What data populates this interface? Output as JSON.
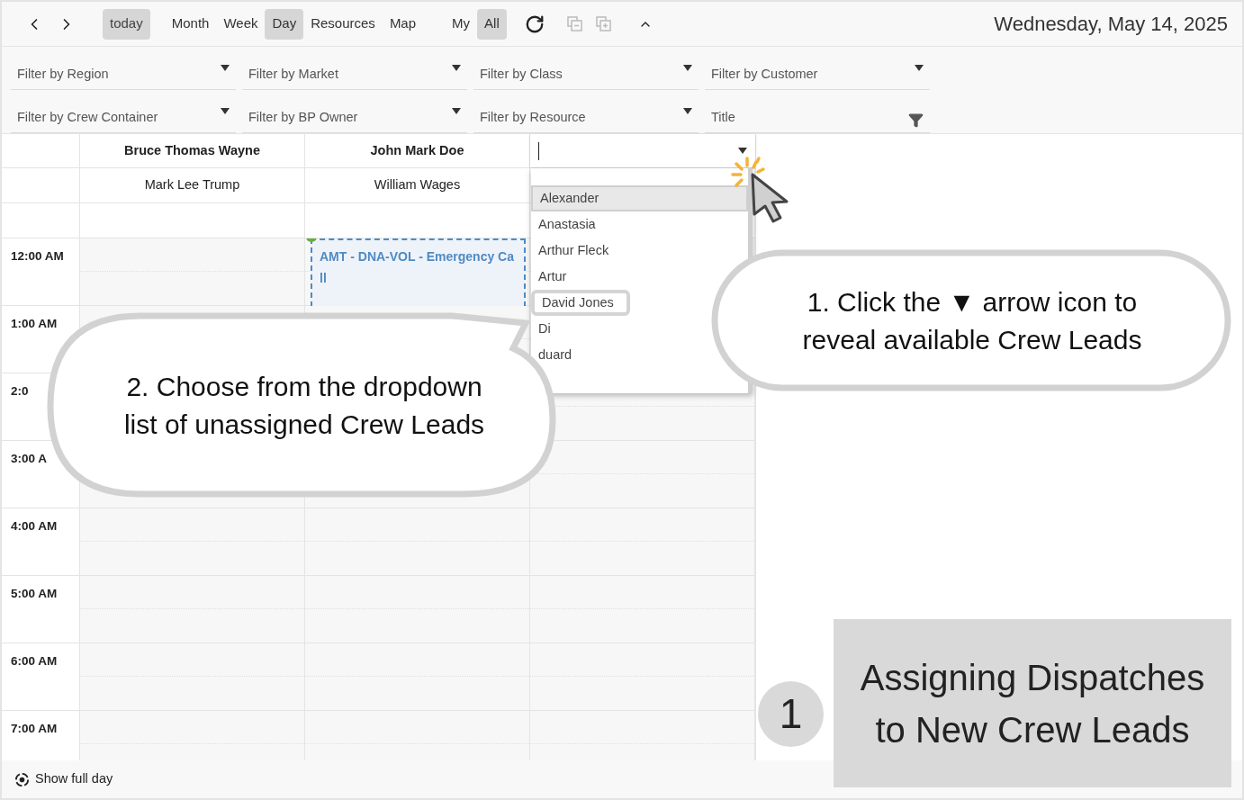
{
  "toolbar": {
    "today": "today",
    "views": [
      {
        "label": "Month",
        "selected": false
      },
      {
        "label": "Week",
        "selected": false
      },
      {
        "label": "Day",
        "selected": true
      },
      {
        "label": "Resources",
        "selected": false
      },
      {
        "label": "Map",
        "selected": false
      }
    ],
    "scopes": [
      {
        "label": "My",
        "selected": false
      },
      {
        "label": "All",
        "selected": true
      }
    ],
    "date": "Wednesday, May 14, 2025"
  },
  "filters": [
    {
      "kind": "dropdown",
      "placeholder": "Filter by Region"
    },
    {
      "kind": "dropdown",
      "placeholder": "Filter by Market"
    },
    {
      "kind": "dropdown",
      "placeholder": "Filter by Class"
    },
    {
      "kind": "dropdown",
      "placeholder": "Filter by Customer"
    },
    {
      "kind": "dropdown",
      "placeholder": "Filter by Crew Container"
    },
    {
      "kind": "dropdown",
      "placeholder": "Filter by BP Owner"
    },
    {
      "kind": "dropdown",
      "placeholder": "Filter by Resource"
    },
    {
      "kind": "text",
      "placeholder": "Title"
    }
  ],
  "resources": [
    {
      "kind": "named",
      "name": "Bruce Thomas Wayne",
      "crew_lead": "Mark Lee Trump"
    },
    {
      "kind": "named",
      "name": "John Mark Doe",
      "crew_lead": "William Wages",
      "event": {
        "title": "AMT - DNA-VOL - Emergency Call"
      }
    },
    {
      "kind": "picker"
    }
  ],
  "crew_picker": {
    "options": [
      {
        "label": "Alexander",
        "selected": true,
        "highlighted": false
      },
      {
        "label": "Anastasia",
        "selected": false,
        "highlighted": false
      },
      {
        "label": "Arthur Fleck",
        "selected": false,
        "highlighted": false
      },
      {
        "label": "Artur",
        "selected": false,
        "highlighted": false
      },
      {
        "label": "David Jones",
        "selected": false,
        "highlighted": true
      },
      {
        "label": "Di",
        "selected": false,
        "highlighted": false
      },
      {
        "label": "duard",
        "selected": false,
        "highlighted": false
      }
    ]
  },
  "times": [
    "12:00 AM",
    "1:00 AM",
    "2:0",
    "3:00 A",
    "4:00 AM",
    "5:00 AM",
    "6:00 AM",
    "7:00 AM"
  ],
  "callouts": [
    "1. Click the ▼ arrow icon to reveal available Crew Leads",
    "2. Choose from the dropdown list of unassigned Crew Leads"
  ],
  "title_card": {
    "number": "1",
    "text": "Assigning Dispatches to New Crew Leads"
  },
  "footer": "Show full day"
}
